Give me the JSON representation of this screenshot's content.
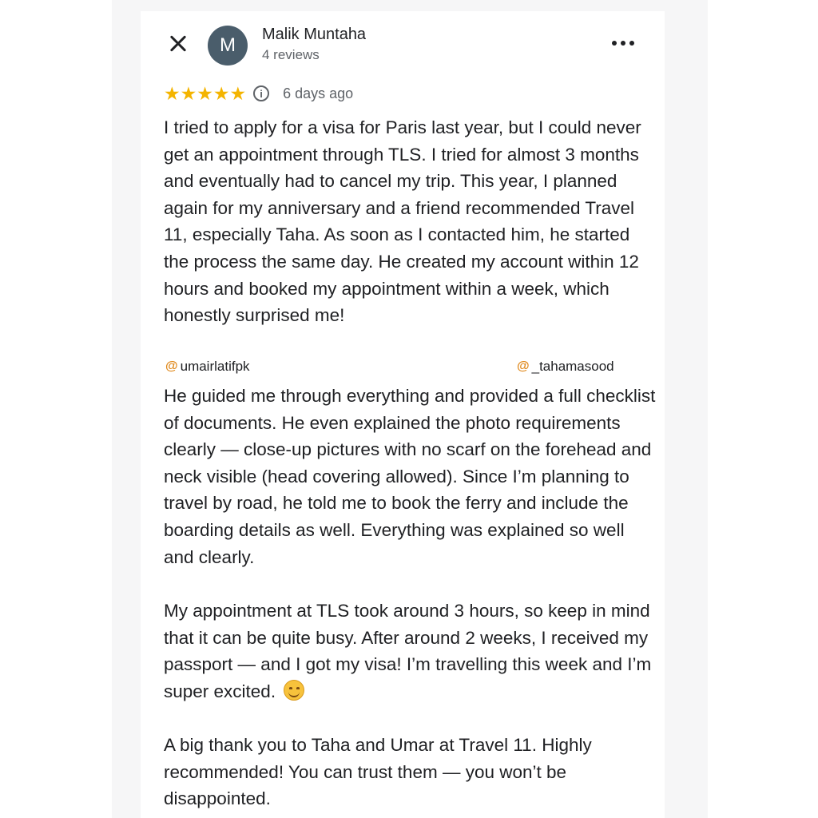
{
  "review": {
    "reviewer_initial": "M",
    "reviewer_name": "Malik Muntaha",
    "reviewer_review_count": "4 reviews",
    "stars": "★★★★★",
    "rating_value": 5,
    "date": "6 days ago",
    "paragraphs": [
      "I tried to apply for a visa for Paris last year, but I could never get an appointment through TLS. I tried for almost 3 months and eventually had to cancel my trip. This year, I planned again for my anniversary and a friend recommended Travel 11, especially Taha. As soon as I contacted him, he started the process the same day. He created my account within 12 hours and booked my appointment within a week, which honestly surprised me!",
      "He guided me through everything and provided a full checklist of documents. He even explained the photo requirements clearly — close-up pictures with no scarf on the forehead and neck visible (head covering allowed). Since I’m planning to travel by road, he told me to book the ferry and include the boarding details as well. Everything was explained so well and clearly.",
      "My appointment at TLS took around 3 hours, so keep in mind that it can be quite busy. After around 2 weeks, I received my passport — and I got my visa! I’m travelling this week and I’m super excited.",
      "A big thank you to Taha and Umar at Travel 11. Highly recommended! You can trust them — you won’t be disappointed."
    ]
  },
  "watermarks": {
    "left": "umairlatifpk",
    "right": "_tahamasood",
    "symbol": "@"
  },
  "colors": {
    "star": "#f4b400",
    "avatar_bg": "#4a5d6b",
    "secondary_text": "#5f6368",
    "watermark_icon": "#e08a1e"
  },
  "icons": {
    "close": "close-icon",
    "more": "more-options-icon",
    "info": "info-icon",
    "emoji": "smiling-face-emoji"
  }
}
